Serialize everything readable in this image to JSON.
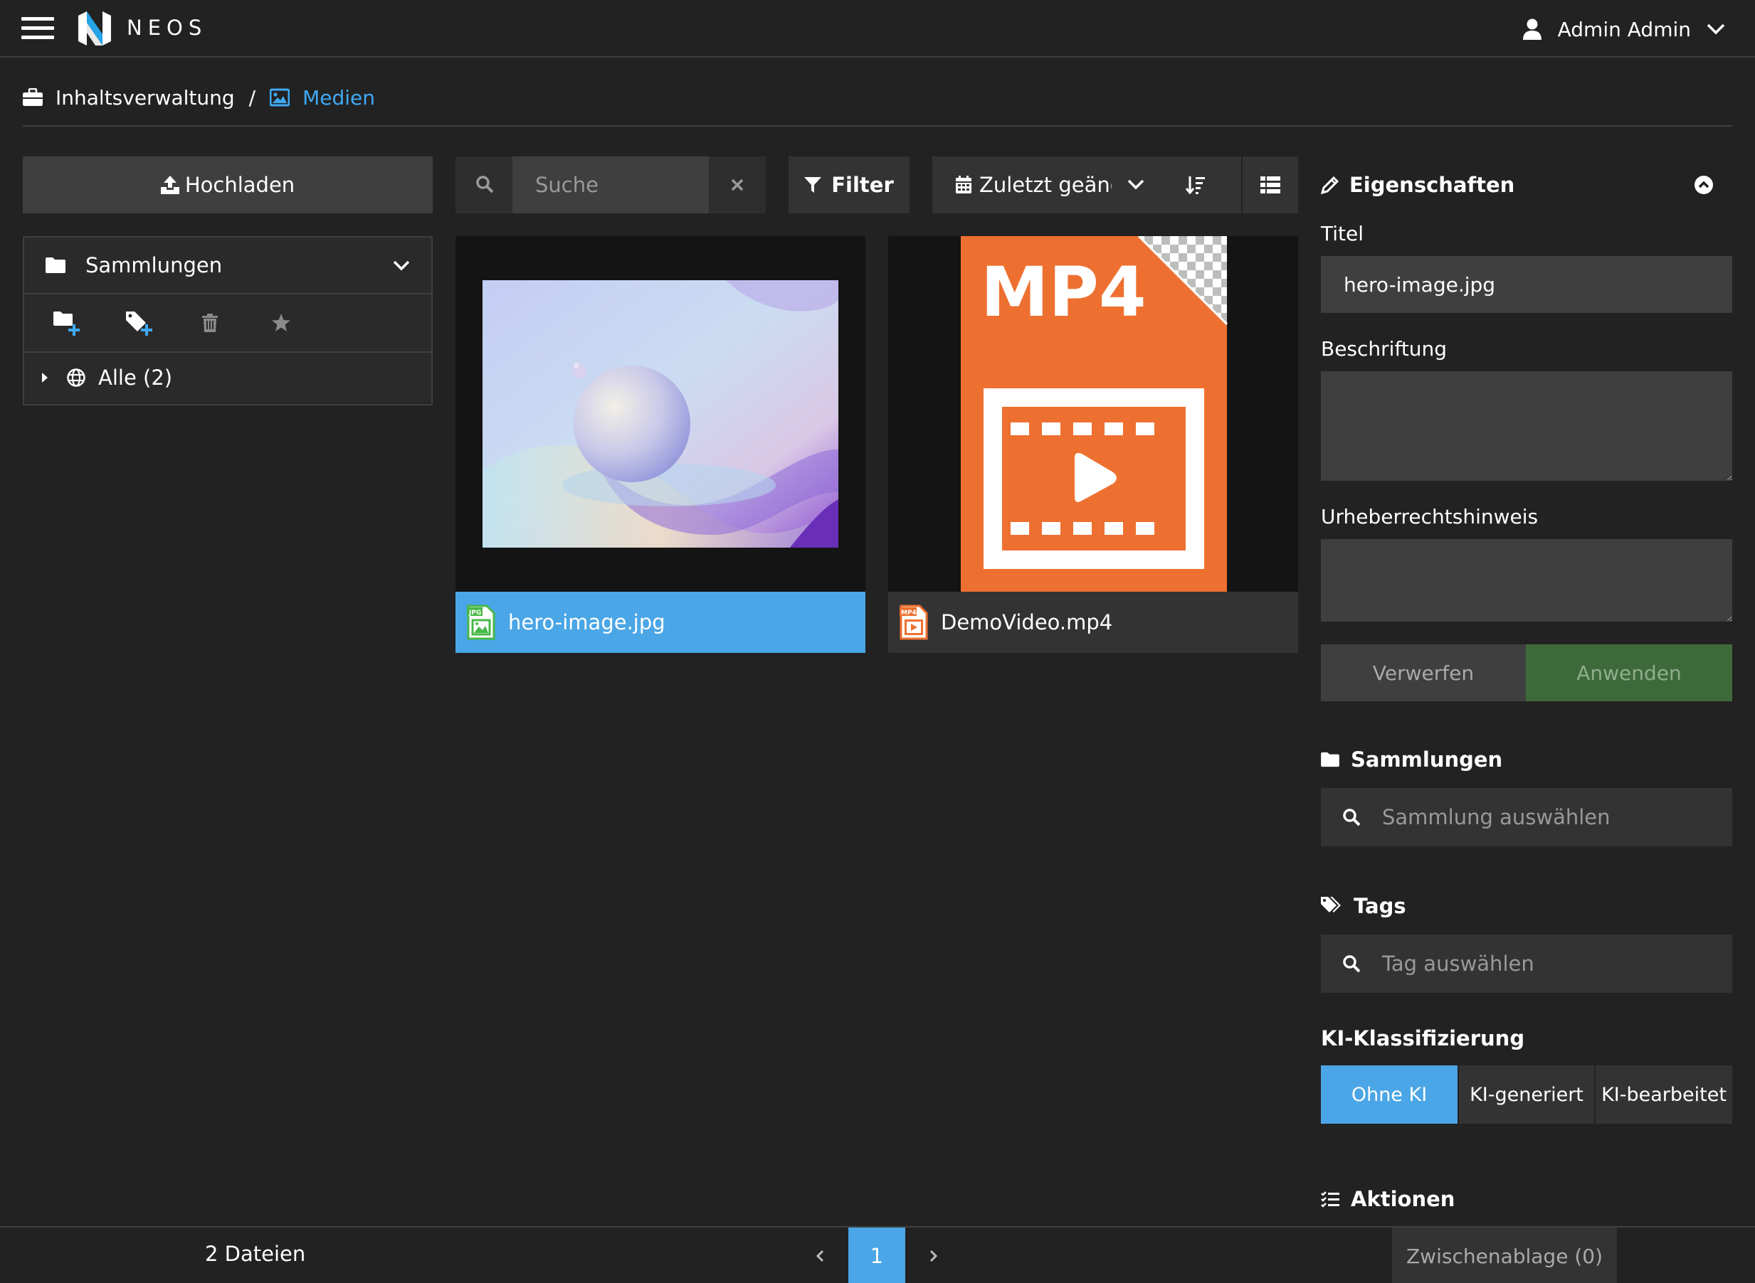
{
  "app": {
    "brand": "NEOS"
  },
  "user": {
    "name": "Admin Admin"
  },
  "breadcrumb": {
    "parent": "Inhaltsverwaltung",
    "separator": "/",
    "current": "Medien"
  },
  "sidebar": {
    "upload_label": "Hochladen",
    "collections_label": "Sammlungen",
    "tree_item": "Alle (2)"
  },
  "toolbar": {
    "search_placeholder": "Suche",
    "filter_label": "Filter",
    "sort_label": "Zuletzt geänd"
  },
  "assets": [
    {
      "filename": "hero-image.jpg",
      "type": "JPG",
      "selected": true
    },
    {
      "filename": "DemoVideo.mp4",
      "type": "MP4",
      "selected": false,
      "thumb_text": "MP4"
    }
  ],
  "properties": {
    "heading": "Eigenschaften",
    "title_label": "Titel",
    "title_value": "hero-image.jpg",
    "caption_label": "Beschriftung",
    "copyright_label": "Urheberrechtshinweis",
    "discard_label": "Verwerfen",
    "apply_label": "Anwenden",
    "collections_heading": "Sammlungen",
    "collections_placeholder": "Sammlung auswählen",
    "tags_heading": "Tags",
    "tags_placeholder": "Tag auswählen",
    "ai_heading": "KI-Klassifizierung",
    "ai_options": [
      "Ohne KI",
      "KI-generiert",
      "KI-bearbeitet"
    ],
    "ai_selected": "Ohne KI",
    "actions_heading": "Aktionen"
  },
  "footer": {
    "file_count": "2 Dateien",
    "current_page": "1",
    "clipboard_label": "Zwischenablage (0)"
  },
  "colors": {
    "accent": "#4aa6e6",
    "link": "#3fa9f5",
    "apply": "#3e6a3b",
    "mp4_orange": "#ee7030",
    "jpg_green": "#47b847"
  }
}
